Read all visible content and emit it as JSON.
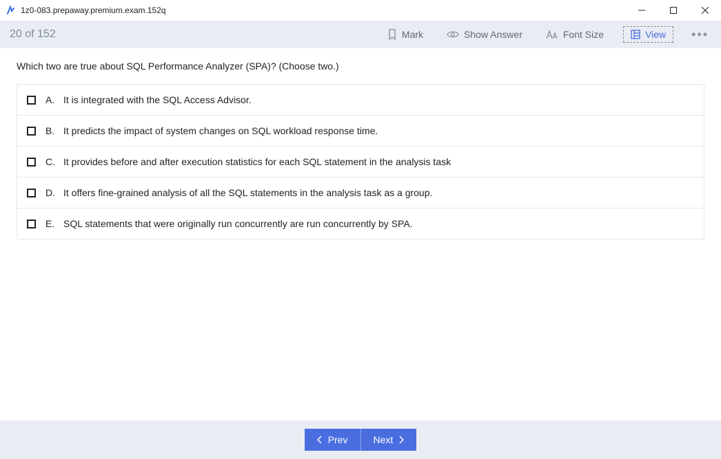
{
  "window": {
    "title": "1z0-083.prepaway.premium.exam.152q"
  },
  "toolbar": {
    "progress": "20 of 152",
    "mark_label": "Mark",
    "show_answer_label": "Show Answer",
    "font_size_label": "Font Size",
    "view_label": "View"
  },
  "question": {
    "text": "Which two are true about SQL Performance Analyzer (SPA)? (Choose two.)",
    "options": [
      {
        "letter": "A.",
        "text": "It is integrated with the SQL Access Advisor."
      },
      {
        "letter": "B.",
        "text": "It predicts the impact of system changes on SQL workload response time."
      },
      {
        "letter": "C.",
        "text": "It provides before and after execution statistics for each SQL statement in the analysis task"
      },
      {
        "letter": "D.",
        "text": "It offers fine-grained analysis of all the SQL statements in the analysis task as a group."
      },
      {
        "letter": "E.",
        "text": "SQL statements that were originally run concurrently are run concurrently by SPA."
      }
    ]
  },
  "footer": {
    "prev_label": "Prev",
    "next_label": "Next"
  }
}
